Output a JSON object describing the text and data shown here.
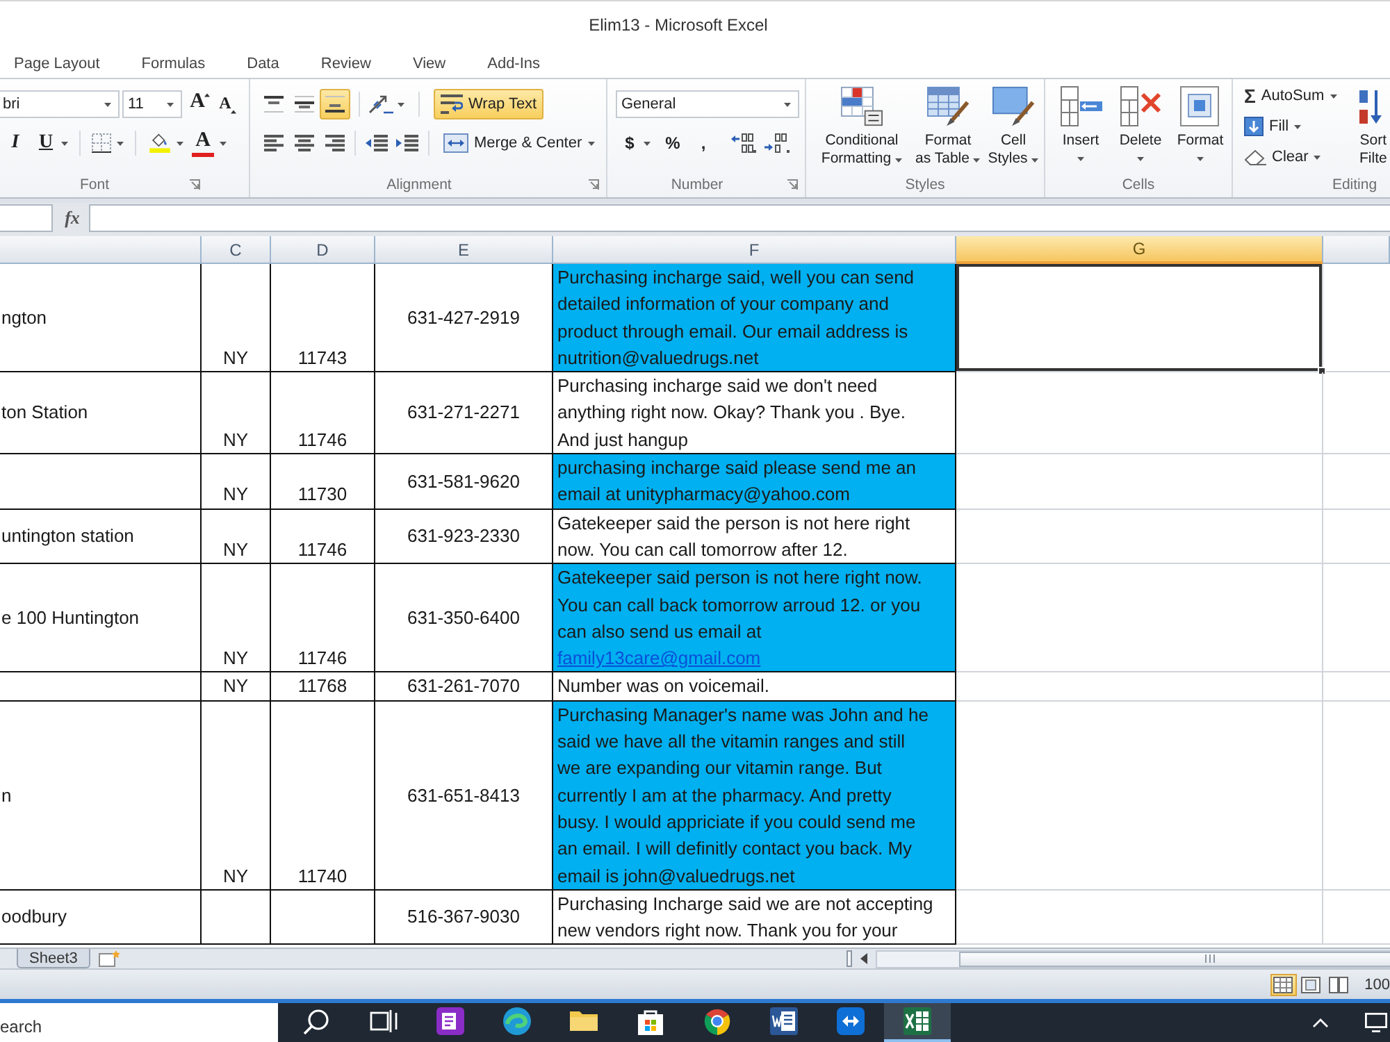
{
  "window": {
    "title": "Elim13 - Microsoft Excel"
  },
  "ribbon": {
    "tabs": [
      {
        "label": "Page Layout",
        "selected": false
      },
      {
        "label": "Formulas",
        "selected": false
      },
      {
        "label": "Data",
        "selected": false
      },
      {
        "label": "Review",
        "selected": false
      },
      {
        "label": "View",
        "selected": false
      },
      {
        "label": "Add-Ins",
        "selected": false
      }
    ],
    "font": {
      "label": "Font",
      "font_name": "bri",
      "font_size": "11",
      "grow_glyph": "A",
      "shrink_glyph": "A",
      "italic_glyph": "I",
      "underline_glyph": "U",
      "color_glyph": "A"
    },
    "alignment": {
      "label": "Alignment",
      "vertical_buttons": [
        {
          "selected": false
        },
        {
          "selected": false
        },
        {
          "selected": true
        }
      ],
      "wrap_text": {
        "label": "Wrap Text",
        "selected": true
      },
      "merge": "Merge & Center"
    },
    "number": {
      "label": "Number",
      "format": "General",
      "currency": "$",
      "percent": "%",
      "comma": ","
    },
    "styles": {
      "label": "Styles",
      "buttons": [
        "Conditional\nFormatting",
        "Format\nas Table",
        "Cell\nStyles"
      ]
    },
    "cells": {
      "label": "Cells",
      "buttons": [
        "Insert",
        "Delete",
        "Format"
      ]
    },
    "editing": {
      "label": "Editing",
      "autosum_glyph": "Σ",
      "autosum": "AutoSum",
      "fill": "Fill",
      "clear": "Clear",
      "sort_filter": "Sort\nFilte"
    }
  },
  "formula_bar": {
    "function_glyph": "fx"
  },
  "sheet": {
    "columns": [
      {
        "selected": false
      },
      {
        "label": "C",
        "selected": false
      },
      {
        "label": "D",
        "selected": false
      },
      {
        "label": "E",
        "selected": false
      },
      {
        "label": "F",
        "selected": false
      },
      {
        "label": "G",
        "selected": true
      },
      {
        "selected": false
      }
    ],
    "rows": [
      {
        "b": "ngton",
        "c": "NY",
        "d": "11743",
        "e": "631-427-2919",
        "f": {
          "text": "Purchasing incharge said, well you can send\ndetailed information of your company and\nproduct through email. Our email address is\nnutrition@valuedrugs.net",
          "highlighted": true
        },
        "g": {
          "selected": true
        }
      },
      {
        "b": "ton Station",
        "c": "NY",
        "d": "11746",
        "e": "631-271-2271",
        "f": {
          "text": "Purchasing incharge said we don't need\nanything right now. Okay? Thank you . Bye.\nAnd just hangup",
          "highlighted": false
        },
        "g": {
          "selected": false
        }
      },
      {
        "c": "NY",
        "d": "11730",
        "e": "631-581-9620",
        "f": {
          "text": "purchasing incharge said please send me an\nemail at unitypharmacy@yahoo.com",
          "highlighted": true
        },
        "g": {
          "selected": false
        }
      },
      {
        "b": "untington station",
        "c": "NY",
        "d": "11746",
        "e": "631-923-2330",
        "f": {
          "text": "Gatekeeper said the person is not here right\nnow. You can call tomorrow after 12.",
          "highlighted": false
        },
        "g": {
          "selected": false
        }
      },
      {
        "b": "e 100 Huntington",
        "c": "NY",
        "d": "11746",
        "e": "631-350-6400",
        "f": {
          "text": "Gatekeeper said person is not here right now.\nYou can call back tomorrow arroud 12. or you\ncan also send us email at",
          "link": "family13care@gmail.com",
          "highlighted": true
        },
        "g": {
          "selected": false
        }
      },
      {
        "c": "NY",
        "d": "11768",
        "e": "631-261-7070",
        "f": {
          "text": "Number was on voicemail.",
          "highlighted": false
        },
        "g": {
          "selected": false
        }
      },
      {
        "b": "n",
        "c": "NY",
        "d": "11740",
        "e": "631-651-8413",
        "f": {
          "text": "Purchasing Manager's name was John and he\nsaid we have all the vitamin ranges and still\nwe are expanding our vitamin range. But\ncurrently I am at the pharmacy. And pretty\nbusy. I would appriciate if you could send me\nan email. I will definitly contact you back. My\nemail is john@valuedrugs.net",
          "highlighted": true
        },
        "g": {
          "selected": false
        }
      },
      {
        "b": "oodbury",
        "e": "516-367-9030",
        "f": {
          "text": "Purchasing Incharge said we are not accepting\nnew vendors right now. Thank you for your",
          "highlighted": false
        },
        "g": {
          "selected": false
        }
      }
    ]
  },
  "sheet_tabs": [
    {
      "label": "Sheet3",
      "selected": false
    }
  ],
  "status_bar": {
    "view_buttons": [
      {
        "selected": true
      },
      {
        "selected": false
      },
      {
        "selected": false
      }
    ],
    "zoom": "100"
  },
  "taskbar": {
    "search_placeholder": "earch",
    "buttons": [
      {
        "active": false
      },
      {
        "active": false
      },
      {
        "active": false
      },
      {
        "active": false
      },
      {
        "active": false
      },
      {
        "active": false
      },
      {
        "active": false
      },
      {
        "active": false
      },
      {
        "active": false
      },
      {
        "active": true
      }
    ]
  }
}
